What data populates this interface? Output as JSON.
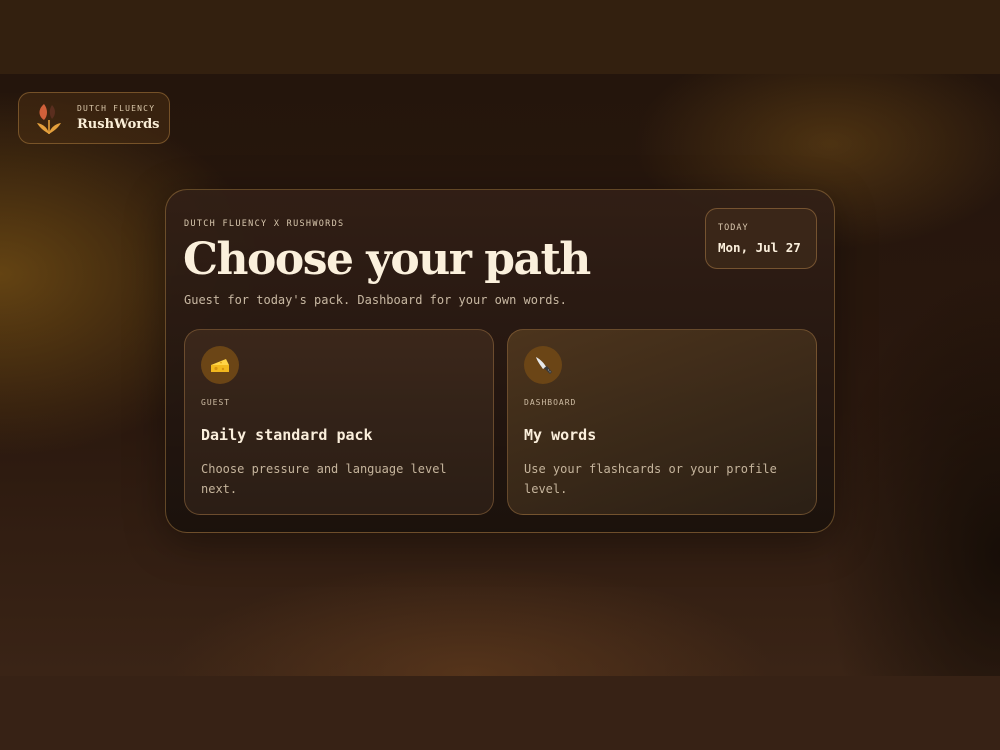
{
  "brand": {
    "eyebrow": "DUTCH FLUENCY",
    "name": "RushWords",
    "logo_icon": "wheat-tulip-logo-icon"
  },
  "hero": {
    "eyebrow": "DUTCH FLUENCY X RUSHWORDS",
    "title": "Choose your path",
    "subtitle": "Guest for today's pack. Dashboard for your own words."
  },
  "today": {
    "label": "TODAY",
    "date": "Mon, Jul 27"
  },
  "options": [
    {
      "icon": "cheese-icon",
      "tag": "GUEST",
      "title": "Daily standard pack",
      "description": "Choose pressure and language level next."
    },
    {
      "icon": "knife-icon",
      "tag": "DASHBOARD",
      "title": "My words",
      "description": "Use your flashcards or your profile level."
    }
  ],
  "colors": {
    "background": "#2a180e",
    "accent": "#6b4516",
    "text_primary": "#fbf0dc",
    "text_muted": "#c8b8a2",
    "border": "#aa7d41"
  }
}
